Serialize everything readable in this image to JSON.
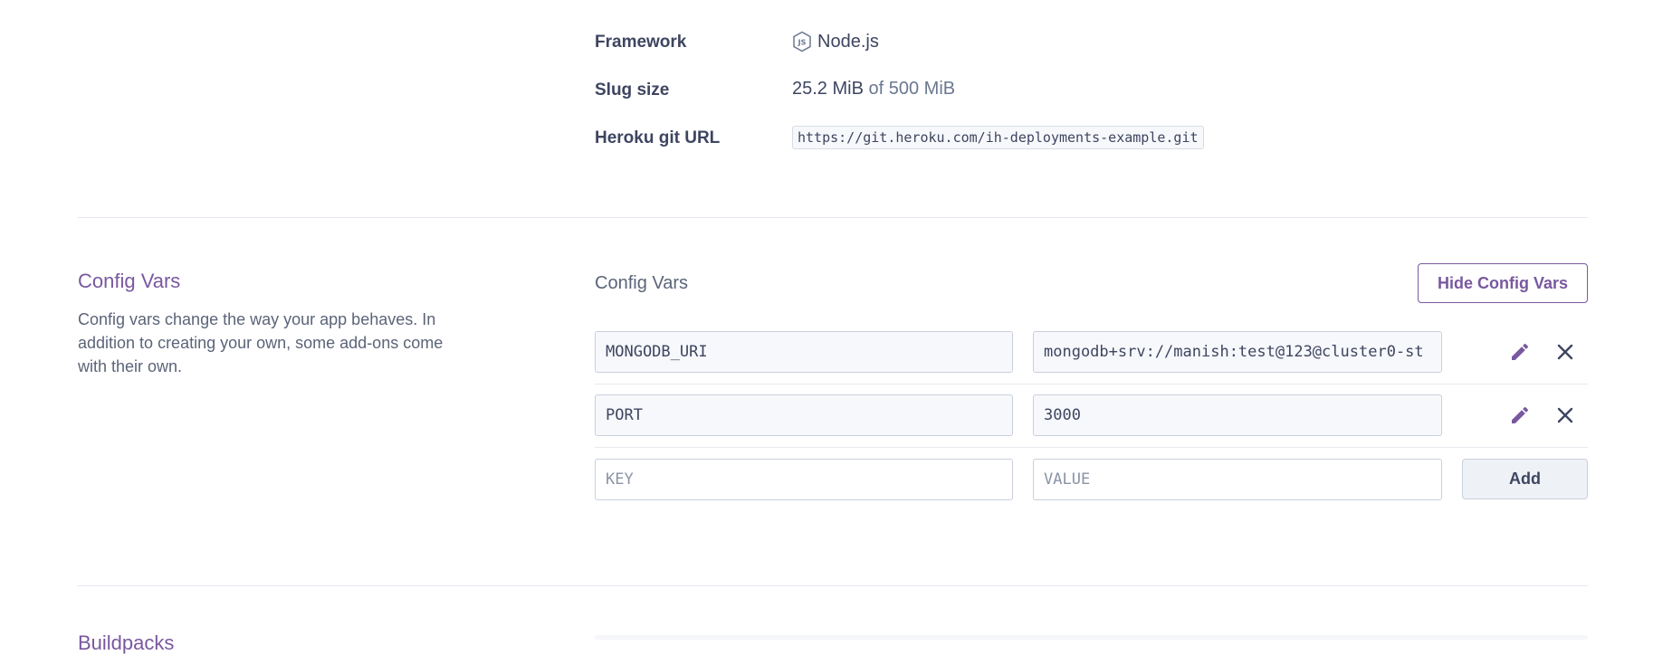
{
  "app_info": {
    "framework": {
      "label": "Framework",
      "icon": "nodejs-icon",
      "value": "Node.js"
    },
    "slug_size": {
      "label": "Slug size",
      "value": "25.2 MiB",
      "limit": "of 500 MiB"
    },
    "git_url": {
      "label": "Heroku git URL",
      "value": "https://git.heroku.com/ih-deployments-example.git"
    }
  },
  "config_vars": {
    "section_title": "Config Vars",
    "description": "Config vars change the way your app behaves. In addition to creating your own, some add-ons come with their own.",
    "subheading": "Config Vars",
    "toggle_button": "Hide Config Vars",
    "vars": [
      {
        "key": "MONGODB_URI",
        "value": "mongodb+srv://manish:test@123@cluster0-st"
      },
      {
        "key": "PORT",
        "value": "3000"
      }
    ],
    "new_var": {
      "key_placeholder": "KEY",
      "value_placeholder": "VALUE",
      "add_label": "Add"
    }
  },
  "next_section": {
    "title": "Buildpacks"
  },
  "colors": {
    "accent": "#79589f",
    "text": "#3e4560",
    "border": "#c9cfdb"
  }
}
